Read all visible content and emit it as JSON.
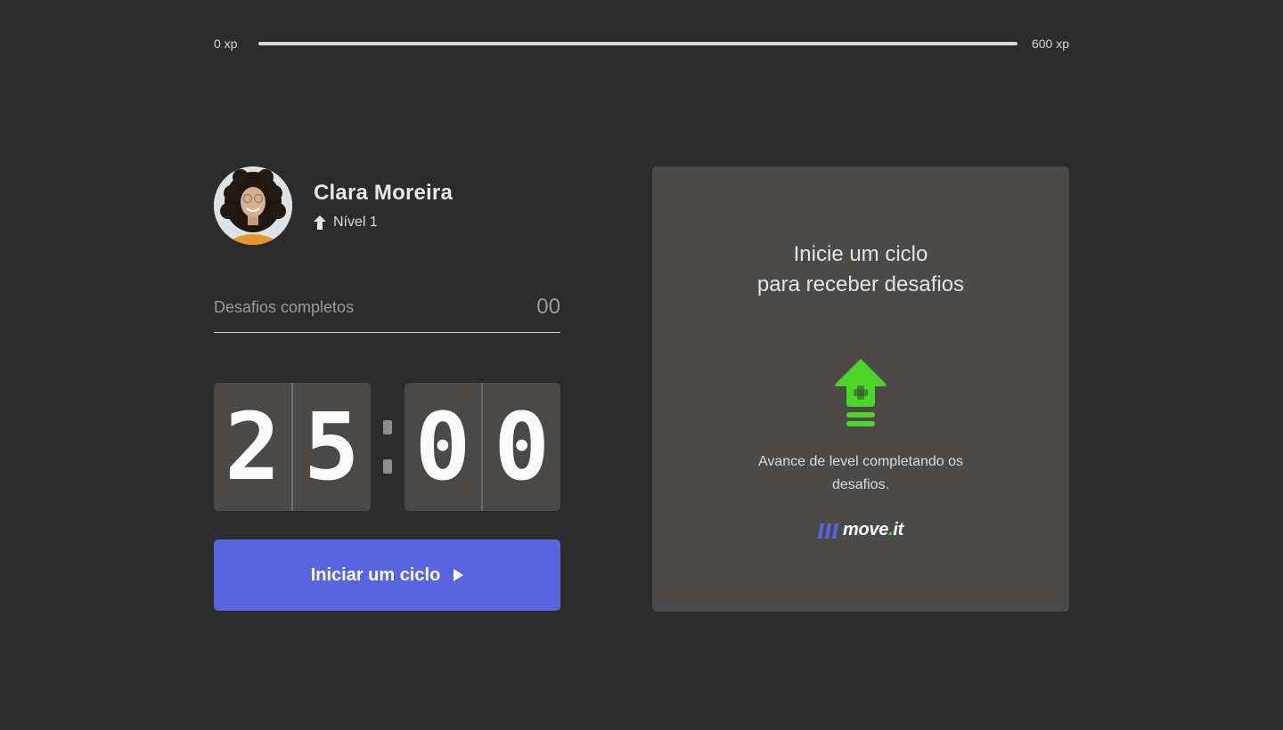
{
  "xp": {
    "min_label": "0 xp",
    "max_label": "600 xp",
    "progress": 0,
    "fill_color": "#4cd62b"
  },
  "profile": {
    "name": "Clara Moreira",
    "level_label": "Nível 1",
    "level_icon": "level-arrow-icon"
  },
  "challenges": {
    "label": "Desafios completos",
    "count": "00"
  },
  "countdown": {
    "minute_left": "2",
    "minute_right": "5",
    "second_left": "0",
    "second_right": "0"
  },
  "start_button": {
    "label": "Iniciar um ciclo",
    "icon": "play-icon",
    "color": "#5965e0"
  },
  "challenge_card": {
    "title": "Inicie um ciclo\npara receber desafios",
    "icon": "level-up-icon",
    "text": "Avance de level completando os desafios.",
    "logo_text_main": "move",
    "logo_text_dot": ".",
    "logo_text_end": "it"
  },
  "colors": {
    "background": "#2c2c2c",
    "card": "#4b4a49",
    "accent_green": "#4cd62b",
    "primary_blue": "#5965e0"
  }
}
